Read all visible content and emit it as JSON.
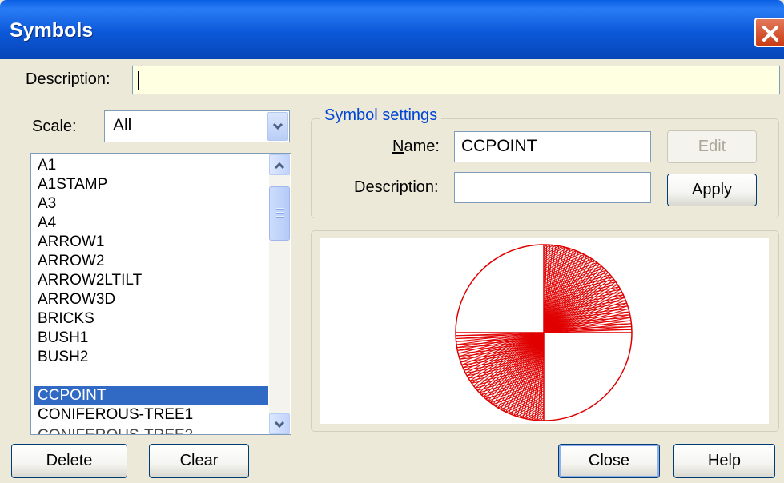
{
  "window": {
    "title": "Symbols"
  },
  "description": {
    "label": "Description:",
    "value": ""
  },
  "scale": {
    "label": "Scale:",
    "selected": "All"
  },
  "symbols": {
    "items": [
      "A1",
      "A1STAMP",
      "A3",
      "A4",
      "ARROW1",
      "ARROW2",
      "ARROW2LTILT",
      "ARROW3D",
      "BRICKS",
      "BUSH1",
      "BUSH2",
      "CCPOINT",
      "CONIFEROUS-TREE1"
    ],
    "selected": "CCPOINT"
  },
  "symbol_settings": {
    "legend": "Symbol settings",
    "name_label": "Name:",
    "name_value": "CCPOINT",
    "description_label": "Description:",
    "description_value": "",
    "edit_label": "Edit",
    "apply_label": "Apply"
  },
  "preview": {
    "symbol": "CCPOINT",
    "stroke_color": "#e00000"
  },
  "buttons": {
    "delete": "Delete",
    "clear": "Clear",
    "close": "Close",
    "help": "Help"
  },
  "colors": {
    "selection": "#316ac5",
    "titlebar": "#0a5fe4",
    "group_legend": "#0046d5"
  }
}
